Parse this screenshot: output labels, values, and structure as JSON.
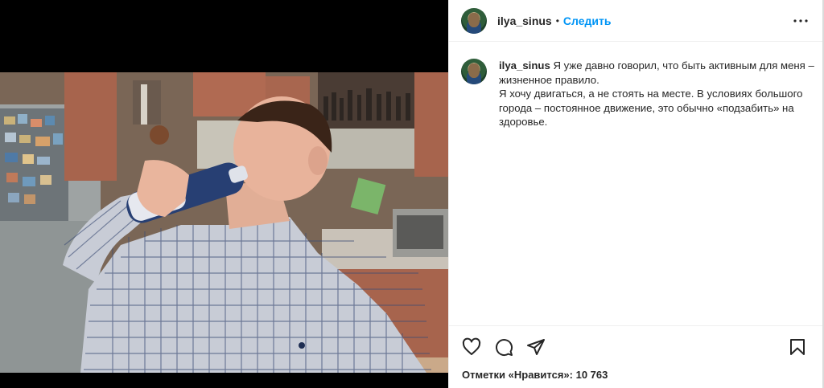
{
  "post": {
    "author": "ilya_sinus",
    "separator": "•",
    "follow_label": "Следить",
    "more_icon": "more-horizontal-icon"
  },
  "caption": {
    "author": "ilya_sinus",
    "text_line1": " Я уже давно говорил, что быть активным для меня –",
    "text_line2": "жизненное правило.",
    "text_line3": "Я хочу двигаться, а не стоять на месте. В условиях большого",
    "text_line4": "города – постоянное движение, это обычно «подзабить» на",
    "text_line5": "здоровье."
  },
  "actions": {
    "like_icon": "heart-icon",
    "comment_icon": "comment-icon",
    "share_icon": "paper-plane-icon",
    "save_icon": "bookmark-icon",
    "likes_text": "Отметки «Нравится»: 10 763"
  },
  "colors": {
    "link": "#0095f6",
    "text": "#262626",
    "border": "#efefef"
  }
}
